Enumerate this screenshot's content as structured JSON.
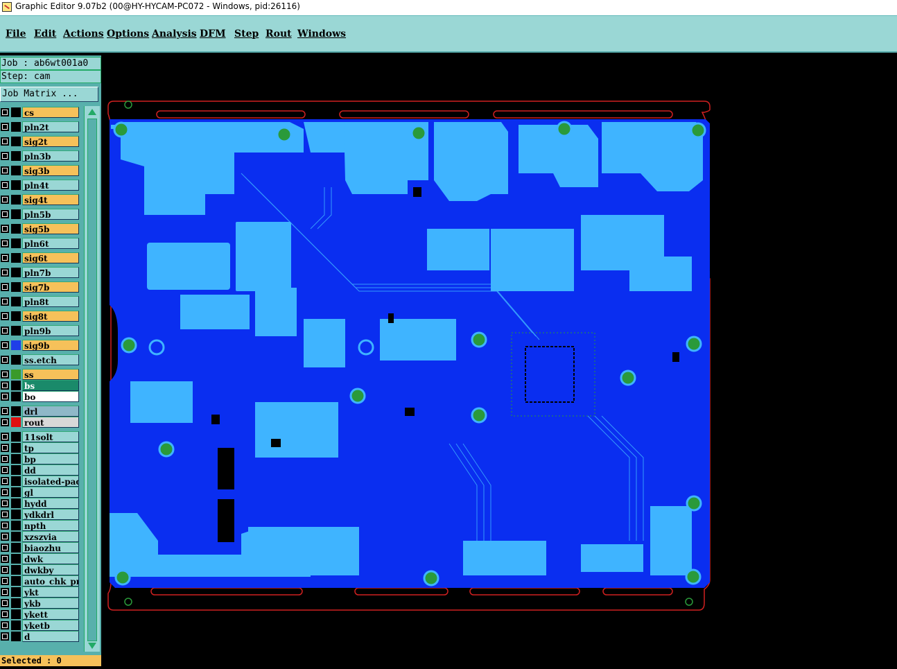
{
  "window": {
    "title": "Graphic Editor 9.07b2 (00@HY-HYCAM-PC072 - Windows, pid:26116)"
  },
  "menu": [
    "File",
    "Edit",
    "Actions",
    "Options",
    "Analysis",
    "DFM",
    "Step",
    "Rout",
    "Windows"
  ],
  "job": {
    "job_line": "Job : ab6wt001a0",
    "step_line": "Step: cam",
    "matrix_button": "Job Matrix ..."
  },
  "layers": [
    {
      "name": "cs",
      "style": "sig",
      "swatch": ""
    },
    {
      "name": "pln2t",
      "style": "pln",
      "swatch": ""
    },
    {
      "name": "sig2t",
      "style": "sig",
      "swatch": ""
    },
    {
      "name": "pln3b",
      "style": "pln",
      "swatch": ""
    },
    {
      "name": "sig3b",
      "style": "sig",
      "swatch": ""
    },
    {
      "name": "pln4t",
      "style": "pln",
      "swatch": ""
    },
    {
      "name": "sig4t",
      "style": "sig",
      "swatch": ""
    },
    {
      "name": "pln5b",
      "style": "pln",
      "swatch": ""
    },
    {
      "name": "sig5b",
      "style": "sig",
      "swatch": ""
    },
    {
      "name": "pln6t",
      "style": "pln",
      "swatch": ""
    },
    {
      "name": "sig6t",
      "style": "sig",
      "swatch": ""
    },
    {
      "name": "pln7b",
      "style": "pln",
      "swatch": ""
    },
    {
      "name": "sig7b",
      "style": "sig",
      "swatch": ""
    },
    {
      "name": "pln8t",
      "style": "pln",
      "swatch": ""
    },
    {
      "name": "sig8t",
      "style": "sig",
      "swatch": ""
    },
    {
      "name": "pln9b",
      "style": "pln",
      "swatch": ""
    },
    {
      "name": "sig9b",
      "style": "sig",
      "swatch": "#1f3ee8"
    },
    {
      "name": "ss.etch",
      "style": "pln",
      "swatch": ""
    },
    {
      "name": "ss",
      "style": "sig",
      "swatch": "#3a9a2a"
    },
    {
      "name": "bs",
      "style": "bs",
      "swatch": ""
    },
    {
      "name": "bo",
      "style": "bo",
      "swatch": ""
    },
    {
      "name": "drl",
      "style": "drl",
      "swatch": ""
    },
    {
      "name": "rout",
      "style": "rout",
      "swatch": "#e01010"
    },
    {
      "name": "11solt",
      "style": "pln",
      "swatch": ""
    },
    {
      "name": "tp",
      "style": "pln",
      "swatch": ""
    },
    {
      "name": "bp",
      "style": "pln",
      "swatch": ""
    },
    {
      "name": "dd",
      "style": "pln",
      "swatch": ""
    },
    {
      "name": "isolated-pad",
      "style": "pln",
      "swatch": ""
    },
    {
      "name": "gl",
      "style": "pln",
      "swatch": ""
    },
    {
      "name": "hydd",
      "style": "pln",
      "swatch": ""
    },
    {
      "name": "ydkdrl",
      "style": "pln",
      "swatch": ""
    },
    {
      "name": "npth",
      "style": "pln",
      "swatch": ""
    },
    {
      "name": "xzszvia",
      "style": "pln",
      "swatch": ""
    },
    {
      "name": "biaozhu",
      "style": "pln",
      "swatch": ""
    },
    {
      "name": "dwk",
      "style": "pln",
      "swatch": ""
    },
    {
      "name": "dwkby",
      "style": "pln",
      "swatch": ""
    },
    {
      "name": "auto_chk_pm",
      "style": "pln",
      "swatch": ""
    },
    {
      "name": "ykt",
      "style": "pln",
      "swatch": ""
    },
    {
      "name": "ykb",
      "style": "pln",
      "swatch": ""
    },
    {
      "name": "ykett",
      "style": "pln",
      "swatch": ""
    },
    {
      "name": "yketb",
      "style": "pln",
      "swatch": ""
    },
    {
      "name": "d",
      "style": "pln",
      "swatch": ""
    }
  ],
  "status": {
    "selected": "Selected : 0"
  },
  "colors": {
    "copper_plane": "#0a2ef0",
    "copper_feature": "#3fb4ff",
    "outline": "#d02020",
    "pads": "#2a9a3a"
  }
}
